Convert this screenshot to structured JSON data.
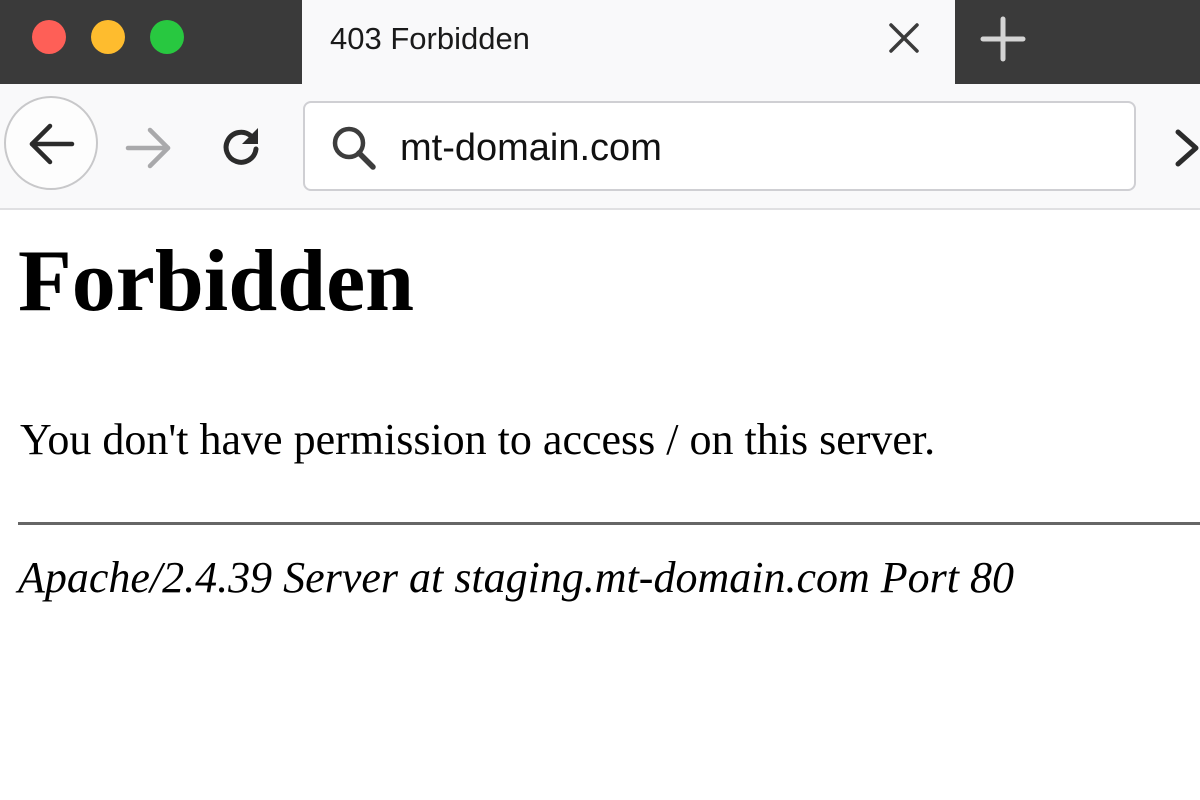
{
  "tab": {
    "title": "403 Forbidden"
  },
  "address_bar": {
    "url": "mt-domain.com"
  },
  "page": {
    "heading": "Forbidden",
    "message": "You don't have permission to access / on this server.",
    "server_signature": "Apache/2.4.39 Server at staging.mt-domain.com Port 80"
  },
  "icons": {
    "window_controls": [
      "close-icon",
      "minimize-icon",
      "maximize-icon"
    ],
    "tab_close": "close-icon",
    "new_tab": "plus-icon",
    "back": "arrow-left-icon",
    "forward": "arrow-right-icon",
    "reload": "reload-icon",
    "search": "search-icon",
    "overflow": "chevron-right-icon"
  },
  "colors": {
    "tabstrip_bg": "#3a3a3a",
    "toolbar_bg": "#f9f9fa",
    "traffic_close": "#fe5f57",
    "traffic_minimize": "#febc2e",
    "traffic_maximize": "#28c840"
  }
}
